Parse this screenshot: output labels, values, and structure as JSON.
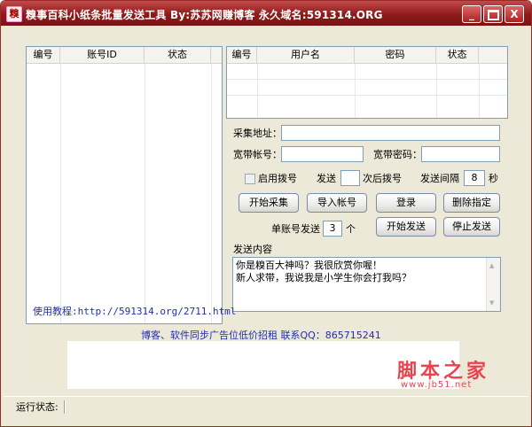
{
  "window": {
    "title": "糗事百科小纸条批量发送工具    By:苏苏网赚博客   永久域名:591314.ORG",
    "min_label": "_",
    "close_label": "X"
  },
  "left_table": {
    "columns": [
      "编号",
      "账号ID",
      "状态"
    ]
  },
  "right_table": {
    "columns": [
      "编号",
      "用户名",
      "密码",
      "状态"
    ]
  },
  "form": {
    "collect_url_label": "采集地址：",
    "collect_url_value": "",
    "broadband_account_label": "宽带帐号：",
    "broadband_account_value": "",
    "broadband_password_label": "宽带密码：",
    "broadband_password_value": "",
    "enable_dial_label": "启用拨号",
    "send_label": "发送",
    "send_value": "",
    "redial_label": "次后拨号",
    "interval_label": "发送间隔",
    "interval_value": "8",
    "seconds_label": "秒",
    "per_account_label": "单账号发送",
    "per_account_value": "3",
    "per_account_unit": "个"
  },
  "buttons": {
    "start_collect": "开始采集",
    "import_accounts": "导入帐号",
    "login": "登录",
    "delete_selected": "删除指定",
    "start_send": "开始发送",
    "stop_send": "停止发送"
  },
  "content": {
    "label": "发送内容",
    "line1": "你是糗百大神吗？我很欣赏你喔！",
    "line2": "新人求带，我说我是小学生你会打我吗？"
  },
  "footer": {
    "tutorial": "使用教程:http://591314.org/2711.html",
    "promo": "博客、软件同步广告位低价招租  联系QQ：865715241",
    "watermark_main": "脚本之家",
    "watermark_url": "www.jb51.net"
  },
  "status": {
    "label": "运行状态:"
  },
  "colors": {
    "title_bar": "#8e1a1a",
    "link": "#1f2fb0",
    "watermark": "#e8434f"
  }
}
